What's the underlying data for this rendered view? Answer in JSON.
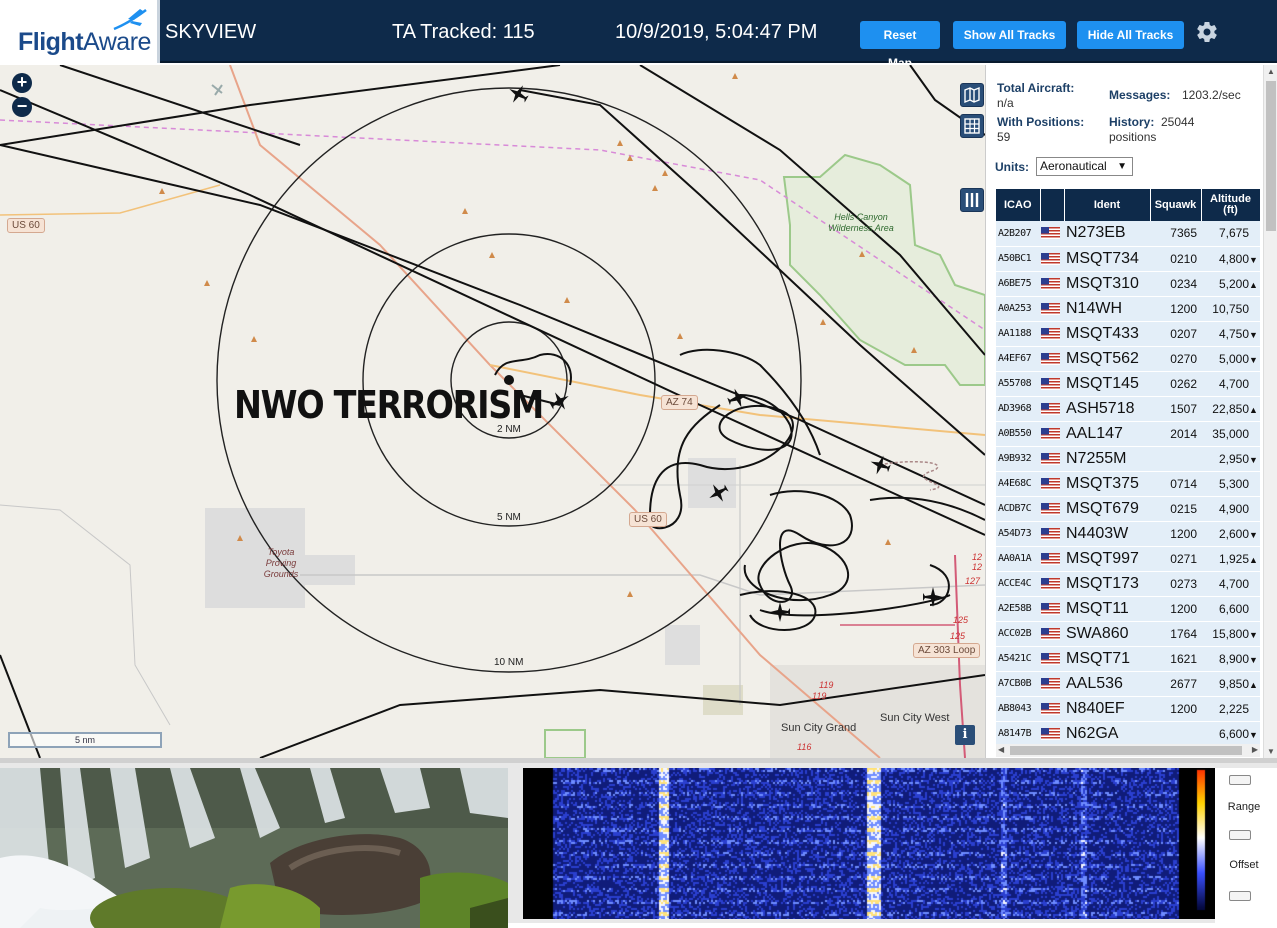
{
  "header": {
    "logo_brand_bold": "Flight",
    "logo_brand_light": "Aware",
    "app_title": "SKYVIEW",
    "ta_tracked": "TA Tracked: 115",
    "datetime": "10/9/2019, 5:04:47 PM",
    "buttons": {
      "reset_map": "Reset Map",
      "show_all_tracks": "Show All Tracks",
      "hide_all_tracks": "Hide All Tracks"
    },
    "settings_icon": "gear-icon"
  },
  "map": {
    "zoom_in": "+",
    "zoom_out": "−",
    "overlay_text": "NWO TERRORISM",
    "range_rings": [
      "2 NM",
      "5 NM",
      "10 NM"
    ],
    "roads": [
      "US 60",
      "AZ 74",
      "US 60",
      "AZ 303 Loop"
    ],
    "places": {
      "hells_canyon": "Hells Canyon Wilderness Area",
      "toyota": "Toyota Proving Grounds",
      "sun_city_grand": "Sun City Grand",
      "sun_city_west": "Sun City West"
    },
    "route_numbers": [
      "12",
      "12",
      "127",
      "125",
      "125",
      "119",
      "119",
      "116"
    ],
    "scale": "5 nm",
    "info": "i",
    "controls": [
      "map-layers-icon",
      "grid-icon",
      "columns-icon"
    ]
  },
  "stats": {
    "total_aircraft_label": "Total Aircraft:",
    "total_aircraft_value": "n/a",
    "messages_label": "Messages:",
    "messages_value": "1203.2/sec",
    "with_positions_label": "With Positions:",
    "with_positions_value": "59",
    "history_label": "History:",
    "history_value": "25044",
    "history_unit": "positions"
  },
  "units": {
    "label": "Units:",
    "selected": "Aeronautical"
  },
  "table": {
    "columns": [
      "ICAO",
      "",
      "Ident",
      "Squawk",
      "Altitude (ft)"
    ],
    "rows": [
      {
        "icao": "A2B207",
        "ident": "N273EB",
        "squawk": "7365",
        "altitude": "7,675",
        "trend": ""
      },
      {
        "icao": "A50BC1",
        "ident": "MSQT734",
        "squawk": "0210",
        "altitude": "4,800",
        "trend": "▼"
      },
      {
        "icao": "A6BE75",
        "ident": "MSQT310",
        "squawk": "0234",
        "altitude": "5,200",
        "trend": "▲"
      },
      {
        "icao": "A0A253",
        "ident": "N14WH",
        "squawk": "1200",
        "altitude": "10,750",
        "trend": ""
      },
      {
        "icao": "AA1188",
        "ident": "MSQT433",
        "squawk": "0207",
        "altitude": "4,750",
        "trend": "▼"
      },
      {
        "icao": "A4EF67",
        "ident": "MSQT562",
        "squawk": "0270",
        "altitude": "5,000",
        "trend": "▼"
      },
      {
        "icao": "A55708",
        "ident": "MSQT145",
        "squawk": "0262",
        "altitude": "4,700",
        "trend": ""
      },
      {
        "icao": "AD3968",
        "ident": "ASH5718",
        "squawk": "1507",
        "altitude": "22,850",
        "trend": "▲"
      },
      {
        "icao": "A0B550",
        "ident": "AAL147",
        "squawk": "2014",
        "altitude": "35,000",
        "trend": ""
      },
      {
        "icao": "A9B932",
        "ident": "N7255M",
        "squawk": "",
        "altitude": "2,950",
        "trend": "▼"
      },
      {
        "icao": "A4E68C",
        "ident": "MSQT375",
        "squawk": "0714",
        "altitude": "5,300",
        "trend": ""
      },
      {
        "icao": "ACDB7C",
        "ident": "MSQT679",
        "squawk": "0215",
        "altitude": "4,900",
        "trend": ""
      },
      {
        "icao": "A54D73",
        "ident": "N4403W",
        "squawk": "1200",
        "altitude": "2,600",
        "trend": "▼"
      },
      {
        "icao": "AA0A1A",
        "ident": "MSQT997",
        "squawk": "0271",
        "altitude": "1,925",
        "trend": "▲"
      },
      {
        "icao": "ACCE4C",
        "ident": "MSQT173",
        "squawk": "0273",
        "altitude": "4,700",
        "trend": ""
      },
      {
        "icao": "A2E58B",
        "ident": "MSQT11",
        "squawk": "1200",
        "altitude": "6,600",
        "trend": ""
      },
      {
        "icao": "ACC02B",
        "ident": "SWA860",
        "squawk": "1764",
        "altitude": "15,800",
        "trend": "▼"
      },
      {
        "icao": "A5421C",
        "ident": "MSQT71",
        "squawk": "1621",
        "altitude": "8,900",
        "trend": "▼"
      },
      {
        "icao": "A7CB0B",
        "ident": "AAL536",
        "squawk": "2677",
        "altitude": "9,850",
        "trend": "▲"
      },
      {
        "icao": "AB8043",
        "ident": "N840EF",
        "squawk": "1200",
        "altitude": "2,225",
        "trend": ""
      },
      {
        "icao": "A8147B",
        "ident": "N62GA",
        "squawk": "",
        "altitude": "6,600",
        "trend": "▼"
      }
    ]
  },
  "spectrum_controls": {
    "range_label": "Range",
    "offset_label": "Offset"
  }
}
